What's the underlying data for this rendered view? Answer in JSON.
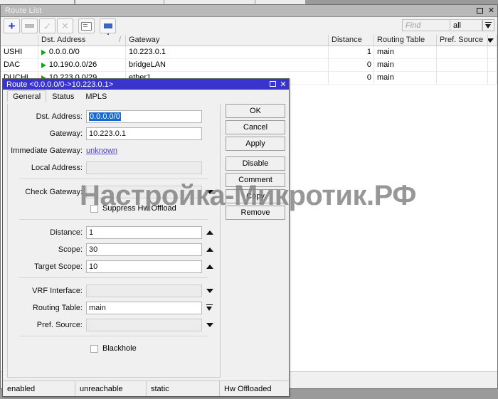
{
  "window": {
    "title": "Route List",
    "buttons": {
      "maximize": "maximize-icon",
      "close": "✕"
    }
  },
  "toolbar": {
    "icons": [
      "add-icon",
      "remove-icon",
      "enable-icon",
      "disable-icon",
      "comment-icon",
      "filter-icon"
    ],
    "find_placeholder": "Find",
    "scope_value": "all"
  },
  "table": {
    "columns": [
      "",
      "Dst. Address",
      "Gateway",
      "Distance",
      "Routing Table",
      "Pref. Source"
    ],
    "sort_marker": "/",
    "rows": [
      {
        "flags": "USHI",
        "dst": "0.0.0.0/0",
        "gateway": "10.223.0.1",
        "distance": "1",
        "routing_table": "main",
        "pref_source": ""
      },
      {
        "flags": "DAC",
        "dst": "10.190.0.0/26",
        "gateway": "bridgeLAN",
        "distance": "0",
        "routing_table": "main",
        "pref_source": ""
      },
      {
        "flags": "DUCHI",
        "dst": "10.223.0.0/29",
        "gateway": "ether1",
        "distance": "0",
        "routing_table": "main",
        "pref_source": ""
      }
    ]
  },
  "dialog": {
    "title": "Route <0.0.0.0/0->10.223.0.1>",
    "tabs": [
      {
        "label": "General",
        "active": true
      },
      {
        "label": "Status",
        "active": false
      },
      {
        "label": "MPLS",
        "active": false
      }
    ],
    "fields": {
      "dst_address_label": "Dst. Address:",
      "dst_address_value": "0.0.0.0/0",
      "gateway_label": "Gateway:",
      "gateway_value": "10.223.0.1",
      "immediate_gateway_label": "Immediate Gateway:",
      "immediate_gateway_value": "unknown",
      "local_address_label": "Local Address:",
      "local_address_value": "",
      "check_gateway_label": "Check Gateway:",
      "check_gateway_value": "",
      "suppress_hw_offload_label": "Suppress Hw Offload",
      "distance_label": "Distance:",
      "distance_value": "1",
      "scope_label": "Scope:",
      "scope_value": "30",
      "target_scope_label": "Target Scope:",
      "target_scope_value": "10",
      "vrf_interface_label": "VRF Interface:",
      "vrf_interface_value": "",
      "routing_table_label": "Routing Table:",
      "routing_table_value": "main",
      "pref_source_label": "Pref. Source:",
      "pref_source_value": "",
      "blackhole_label": "Blackhole"
    },
    "buttons": [
      "OK",
      "Cancel",
      "Apply",
      "Disable",
      "Comment",
      "Copy",
      "Remove"
    ],
    "status": [
      "enabled",
      "unreachable",
      "static",
      "Hw Offloaded"
    ]
  },
  "watermark": {
    "text": "Настройка-Микротик.РФ"
  },
  "colors": {
    "dialog_title_bg": "#3a34cf",
    "window_title_bg": "#b9b9b9",
    "selection_blue": "#1569d4",
    "link_blue": "#4a3fd0",
    "route_arrow_green": "#19a219",
    "desktop_gray": "#9a9a9a"
  }
}
